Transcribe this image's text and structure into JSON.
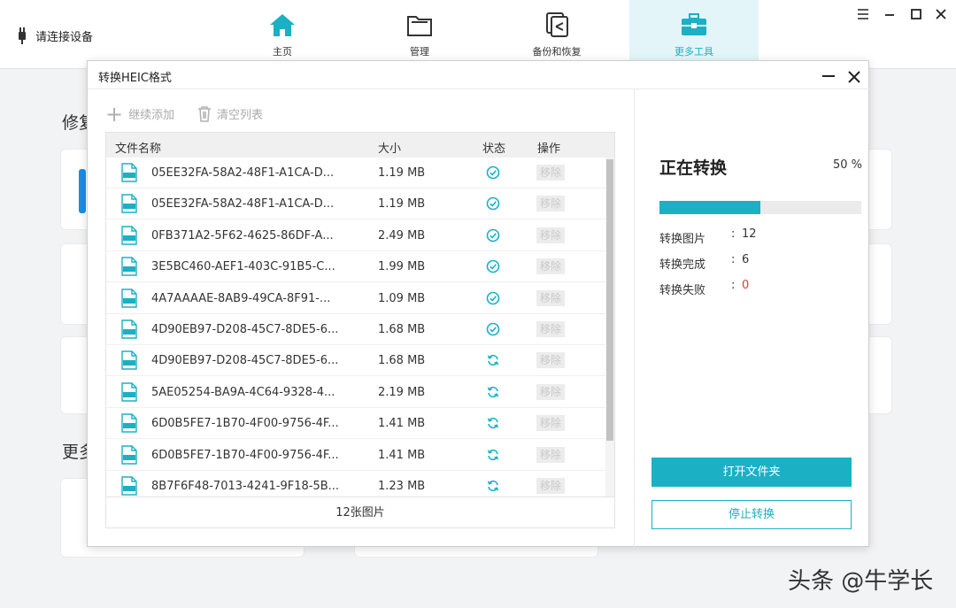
{
  "app": {
    "device_status": "请连接设备",
    "nav": [
      {
        "label": "主页",
        "icon": "home-icon"
      },
      {
        "label": "管理",
        "icon": "folder-icon"
      },
      {
        "label": "备份和恢复",
        "icon": "backup-restore-icon"
      },
      {
        "label": "更多工具",
        "icon": "toolbox-icon"
      }
    ],
    "active_nav": "更多工具",
    "window_controls": [
      "menu-icon",
      "minimize-icon",
      "maximize-icon",
      "close-icon"
    ],
    "background_headings": [
      "修复",
      "更多"
    ]
  },
  "dialog": {
    "title": "转换HEIC格式",
    "toolbar": {
      "add_label": "继续添加",
      "clear_label": "清空列表"
    },
    "table": {
      "headers": [
        "文件名称",
        "大小",
        "状态",
        "操作"
      ],
      "rows": [
        {
          "name": "05EE32FA-58A2-48F1-A1CA-D...",
          "size": "1.19 MB",
          "status": "done",
          "action": "移除"
        },
        {
          "name": "05EE32FA-58A2-48F1-A1CA-D...",
          "size": "1.19 MB",
          "status": "done",
          "action": "移除"
        },
        {
          "name": "0FB371A2-5F62-4625-86DF-A...",
          "size": "2.49 MB",
          "status": "done",
          "action": "移除"
        },
        {
          "name": "3E5BC460-AEF1-403C-91B5-C...",
          "size": "1.99 MB",
          "status": "done",
          "action": "移除"
        },
        {
          "name": "4A7AAAAE-8AB9-49CA-8F91-...",
          "size": "1.09 MB",
          "status": "done",
          "action": "移除"
        },
        {
          "name": "4D90EB97-D208-45C7-8DE5-6...",
          "size": "1.68 MB",
          "status": "done",
          "action": "移除"
        },
        {
          "name": "4D90EB97-D208-45C7-8DE5-6...",
          "size": "1.68 MB",
          "status": "converting",
          "action": "移除"
        },
        {
          "name": "5AE05254-BA9A-4C64-9328-4...",
          "size": "2.19 MB",
          "status": "converting",
          "action": "移除"
        },
        {
          "name": "6D0B5FE7-1B70-4F00-9756-4F...",
          "size": "1.41 MB",
          "status": "converting",
          "action": "移除"
        },
        {
          "name": "6D0B5FE7-1B70-4F00-9756-4F...",
          "size": "1.41 MB",
          "status": "converting",
          "action": "移除"
        },
        {
          "name": "8B7F6F48-7013-4241-9F18-5B...",
          "size": "1.23 MB",
          "status": "converting",
          "action": "移除"
        }
      ],
      "file_icon_text": "HEIC",
      "footer": "12张图片"
    },
    "progress": {
      "title": "正在转换",
      "percent_text": "50 %",
      "fraction": 0.5,
      "stats": [
        {
          "label": "转换图片",
          "value": "12"
        },
        {
          "label": "转换完成",
          "value": "6"
        },
        {
          "label": "转换失败",
          "value": "0"
        }
      ]
    },
    "buttons": {
      "open_folder": "打开文件夹",
      "stop": "停止转换"
    }
  },
  "watermark": "头条 @牛学长",
  "colors": {
    "accent": "#1bb0c4",
    "error": "#e23b3b"
  }
}
